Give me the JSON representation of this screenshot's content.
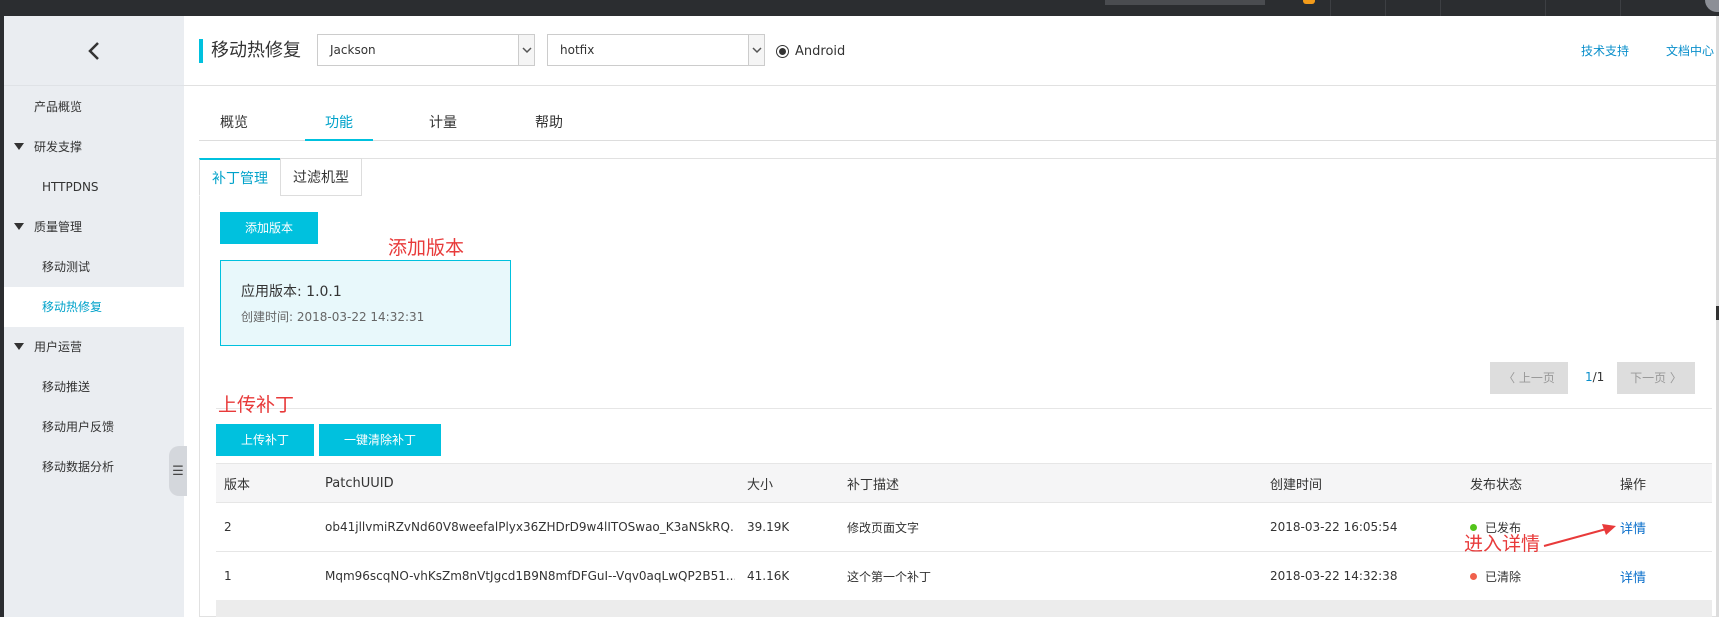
{
  "sidebar": {
    "items": [
      {
        "label": "产品概览"
      },
      {
        "label": "研发支撑"
      },
      {
        "label": "HTTPDNS"
      },
      {
        "label": "质量管理"
      },
      {
        "label": "移动测试"
      },
      {
        "label": "移动热修复"
      },
      {
        "label": "用户运营"
      },
      {
        "label": "移动推送"
      },
      {
        "label": "移动用户反馈"
      },
      {
        "label": "移动数据分析"
      }
    ]
  },
  "header": {
    "title": "移动热修复",
    "account_select": "Jackson",
    "app_select": "hotfix",
    "platform": "Android",
    "links": [
      "技术支持",
      "文档中心"
    ]
  },
  "tabs": [
    "概览",
    "功能",
    "计量",
    "帮助"
  ],
  "subtabs": [
    "补丁管理",
    "过滤机型"
  ],
  "add_version_button": "添加版本",
  "version_card": {
    "title": "应用版本: 1.0.1",
    "created": "创建时间: 2018-03-22 14:32:31"
  },
  "annotations": {
    "add_version": "添加版本",
    "upload_patch": "上传补丁",
    "enter_detail": "进入详情"
  },
  "pager": {
    "prev": "上一页",
    "current": "1",
    "total": "/1",
    "next": "下一页"
  },
  "upload_button": "上传补丁",
  "clear_button": "一键清除补丁",
  "table": {
    "columns": [
      "版本",
      "PatchUUID",
      "大小",
      "补丁描述",
      "创建时间",
      "发布状态",
      "操作"
    ],
    "rows": [
      {
        "version": "2",
        "uuid": "ob41jllvmiRZvNd60V8weefalPlyx36ZHDrD9w4lITOSwao_K3aNSkRQ...",
        "size": "39.19K",
        "desc": "修改页面文字",
        "time": "2018-03-22 16:05:54",
        "status": "已发布",
        "action": "详情"
      },
      {
        "version": "1",
        "uuid": "Mqm96scqNO-vhKsZm8nVtJgcd1B9N8mfDFGuI--Vqv0aqLwQP2B51...",
        "size": "41.16K",
        "desc": "这个第一个补丁",
        "time": "2018-03-22 14:32:38",
        "status": "已清除",
        "action": "详情"
      }
    ]
  },
  "colors": {
    "accent": "#00c1de",
    "published": "#52c41a",
    "cleared": "#f0614c",
    "annotation": "#e83a3a"
  }
}
